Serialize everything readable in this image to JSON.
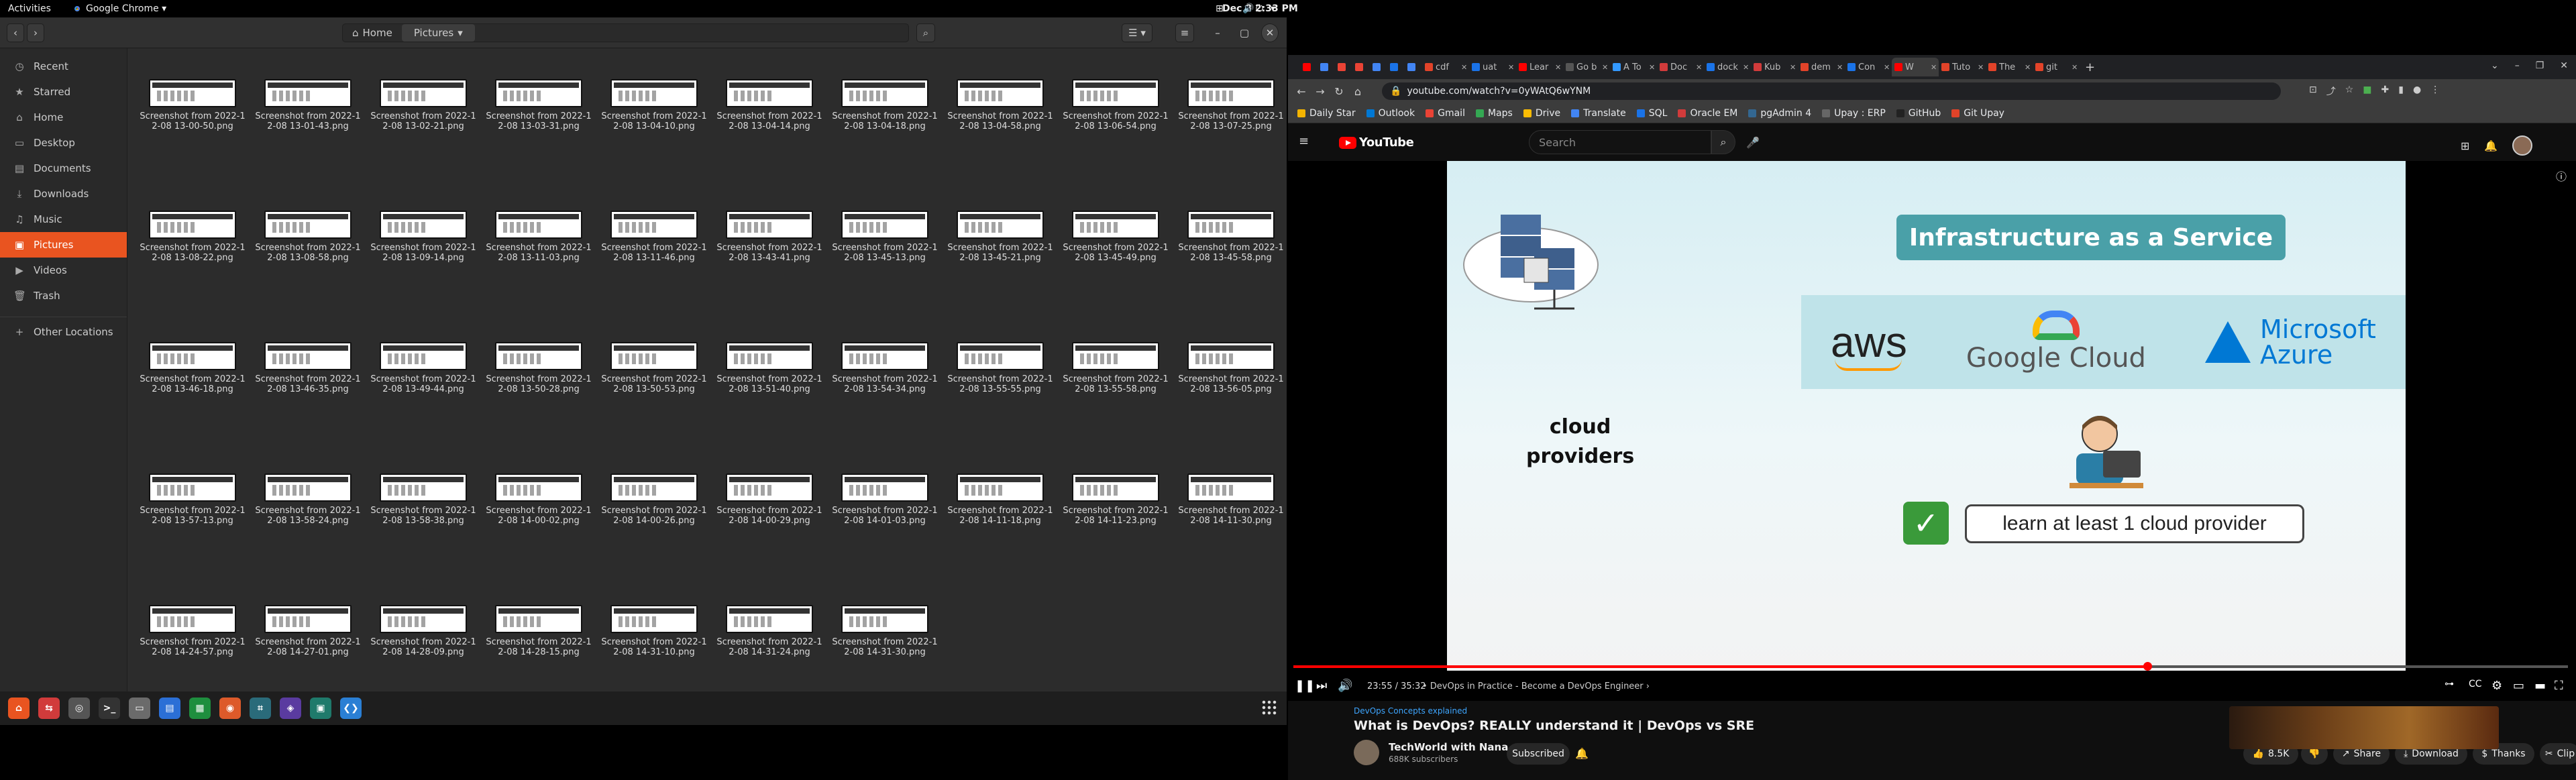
{
  "topbar": {
    "activities": "Activities",
    "app": "Google Chrome ▾",
    "clock": "Dec 8  2:33 PM"
  },
  "files": {
    "path": {
      "home": "Home",
      "current": "Pictures"
    },
    "sidebar": [
      {
        "label": "Recent",
        "icon": "clock-icon",
        "glyph": "◷"
      },
      {
        "label": "Starred",
        "icon": "star-icon",
        "glyph": "★"
      },
      {
        "label": "Home",
        "icon": "home-icon",
        "glyph": "⌂"
      },
      {
        "label": "Desktop",
        "icon": "desktop-icon",
        "glyph": "▭"
      },
      {
        "label": "Documents",
        "icon": "document-icon",
        "glyph": "▤"
      },
      {
        "label": "Downloads",
        "icon": "download-icon",
        "glyph": "⤓"
      },
      {
        "label": "Music",
        "icon": "music-icon",
        "glyph": "♫"
      },
      {
        "label": "Pictures",
        "icon": "image-icon",
        "glyph": "▣"
      },
      {
        "label": "Videos",
        "icon": "video-icon",
        "glyph": "▶"
      },
      {
        "label": "Trash",
        "icon": "trash-icon",
        "glyph": "🗑"
      },
      {
        "label": "Other Locations",
        "icon": "plus-icon",
        "glyph": "+"
      }
    ],
    "items": [
      "Screenshot from 2022-12-08 13-00-50.png",
      "Screenshot from 2022-12-08 13-01-43.png",
      "Screenshot from 2022-12-08 13-02-21.png",
      "Screenshot from 2022-12-08 13-03-31.png",
      "Screenshot from 2022-12-08 13-04-10.png",
      "Screenshot from 2022-12-08 13-04-14.png",
      "Screenshot from 2022-12-08 13-04-18.png",
      "Screenshot from 2022-12-08 13-04-58.png",
      "Screenshot from 2022-12-08 13-06-54.png",
      "Screenshot from 2022-12-08 13-07-25.png",
      "Screenshot from 2022-12-08 13-08-22.png",
      "Screenshot from 2022-12-08 13-08-58.png",
      "Screenshot from 2022-12-08 13-09-14.png",
      "Screenshot from 2022-12-08 13-11-03.png",
      "Screenshot from 2022-12-08 13-11-46.png",
      "Screenshot from 2022-12-08 13-43-41.png",
      "Screenshot from 2022-12-08 13-45-13.png",
      "Screenshot from 2022-12-08 13-45-21.png",
      "Screenshot from 2022-12-08 13-45-49.png",
      "Screenshot from 2022-12-08 13-45-58.png",
      "Screenshot from 2022-12-08 13-46-18.png",
      "Screenshot from 2022-12-08 13-46-35.png",
      "Screenshot from 2022-12-08 13-49-44.png",
      "Screenshot from 2022-12-08 13-50-28.png",
      "Screenshot from 2022-12-08 13-50-53.png",
      "Screenshot from 2022-12-08 13-51-40.png",
      "Screenshot from 2022-12-08 13-54-34.png",
      "Screenshot from 2022-12-08 13-55-55.png",
      "Screenshot from 2022-12-08 13-55-58.png",
      "Screenshot from 2022-12-08 13-56-05.png",
      "Screenshot from 2022-12-08 13-57-13.png",
      "Screenshot from 2022-12-08 13-58-24.png",
      "Screenshot from 2022-12-08 13-58-38.png",
      "Screenshot from 2022-12-08 14-00-02.png",
      "Screenshot from 2022-12-08 14-00-26.png",
      "Screenshot from 2022-12-08 14-00-29.png",
      "Screenshot from 2022-12-08 14-01-03.png",
      "Screenshot from 2022-12-08 14-11-18.png",
      "Screenshot from 2022-12-08 14-11-23.png",
      "Screenshot from 2022-12-08 14-11-30.png",
      "Screenshot from 2022-12-08 14-24-57.png",
      "Screenshot from 2022-12-08 14-27-01.png",
      "Screenshot from 2022-12-08 14-28-09.png",
      "Screenshot from 2022-12-08 14-28-15.png",
      "Screenshot from 2022-12-08 14-31-10.png",
      "Screenshot from 2022-12-08 14-31-24.png",
      "Screenshot from 2022-12-08 14-31-30.png"
    ]
  },
  "dock": [
    {
      "name": "ubuntu-software-icon",
      "color": "#e95420",
      "glyph": "⌂"
    },
    {
      "name": "anydesk-icon",
      "color": "#d13b3b",
      "glyph": "⇆"
    },
    {
      "name": "settings-icon",
      "color": "#555",
      "glyph": "◎"
    },
    {
      "name": "terminal-icon",
      "color": "#333",
      "glyph": ">_"
    },
    {
      "name": "files-icon",
      "color": "#6b6b6b",
      "glyph": "▭"
    },
    {
      "name": "docs-icon",
      "color": "#2b6fd6",
      "glyph": "▤"
    },
    {
      "name": "sheets-icon",
      "color": "#1e8e3e",
      "glyph": "▦"
    },
    {
      "name": "chrome-icon",
      "color": "#dd5a2a",
      "glyph": "◉"
    },
    {
      "name": "screenshot-tool-icon",
      "color": "#2a6b7a",
      "glyph": "⌗"
    },
    {
      "name": "postman-icon",
      "color": "#5a3ba0",
      "glyph": "◈"
    },
    {
      "name": "image-viewer-icon",
      "color": "#1f7a6b",
      "glyph": "▣"
    },
    {
      "name": "vscode-icon",
      "color": "#2a7fd4",
      "glyph": "❮❯"
    }
  ],
  "chrome": {
    "tabs": [
      {
        "label": "",
        "color": "#ff0000"
      },
      {
        "label": "",
        "color": "#4285f4"
      },
      {
        "label": "",
        "color": "#ea4335"
      },
      {
        "label": "",
        "color": "#ea4335"
      },
      {
        "label": "",
        "color": "#4285f4"
      },
      {
        "label": "",
        "color": "#1a73e8"
      },
      {
        "label": "",
        "color": "#4285f4"
      },
      {
        "label": "cdf",
        "color": "#e24329"
      },
      {
        "label": "uat",
        "color": "#1a73e8"
      },
      {
        "label": "Lear",
        "color": "#ff0000"
      },
      {
        "label": "Go b",
        "color": "#555"
      },
      {
        "label": "A To",
        "color": "#3399ff"
      },
      {
        "label": "Doc",
        "color": "#d13b3b"
      },
      {
        "label": "dock",
        "color": "#1a73e8"
      },
      {
        "label": "Kub",
        "color": "#d13b3b"
      },
      {
        "label": "dem",
        "color": "#e24329"
      },
      {
        "label": "Con",
        "color": "#1a73e8"
      },
      {
        "label": "W",
        "color": "#ff0000"
      },
      {
        "label": "Tuto",
        "color": "#e24329"
      },
      {
        "label": "The",
        "color": "#e24329"
      },
      {
        "label": "git",
        "color": "#e24329"
      }
    ],
    "active_tab": 17,
    "url": "youtube.com/watch?v=0yWAtQ6wYNM",
    "bookmarks": [
      {
        "label": "Daily Star",
        "color": "#f4b400"
      },
      {
        "label": "Outlook",
        "color": "#0078d4"
      },
      {
        "label": "Gmail",
        "color": "#ea4335"
      },
      {
        "label": "Maps",
        "color": "#34a853"
      },
      {
        "label": "Drive",
        "color": "#fbbc04"
      },
      {
        "label": "Translate",
        "color": "#4285f4"
      },
      {
        "label": "SQL",
        "color": "#1a73e8"
      },
      {
        "label": "Oracle EM",
        "color": "#d13b3b"
      },
      {
        "label": "pgAdmin 4",
        "color": "#336791"
      },
      {
        "label": "Upay : ERP",
        "color": "#666"
      },
      {
        "label": "GitHub",
        "color": "#222"
      },
      {
        "label": "Git Upay",
        "color": "#e24329"
      }
    ]
  },
  "youtube": {
    "logo": "YouTube",
    "search_placeholder": "Search",
    "slide": {
      "heading": "Infrastructure as a Service",
      "aws": "aws",
      "google": "Google Cloud",
      "azure_1": "Microsoft",
      "azure_2": "Azure",
      "cloud_1": "cloud",
      "cloud_2": "providers",
      "learn": "learn at least 1 cloud provider"
    },
    "time": "23:55 / 35:32",
    "chapter": "• DevOps in Practice - Become a DevOps Engineer ›",
    "kicker": "DevOps Concepts explained",
    "title": "What is DevOps? REALLY understand it | DevOps vs SRE",
    "channel": "TechWorld with Nana",
    "subs": "688K subscribers",
    "subscribed": "Subscribed",
    "likes": "8.5K",
    "share": "Share",
    "download": "Download",
    "thanks": "Thanks",
    "clip": "Clip",
    "progress": 0.67
  }
}
